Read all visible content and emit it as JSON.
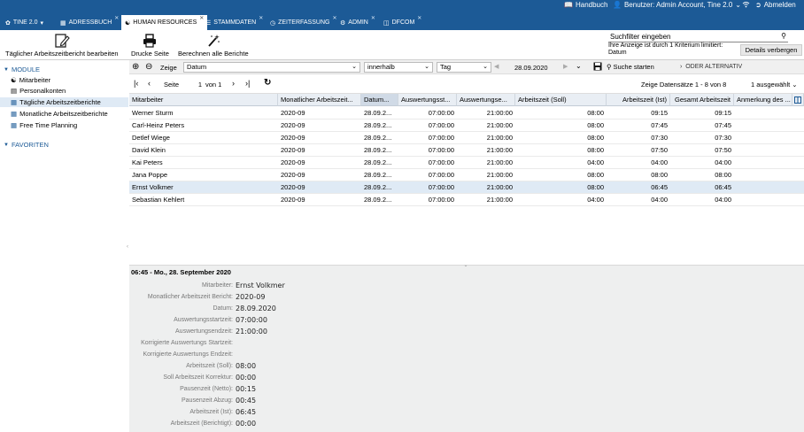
{
  "topbar": {
    "handbuch": "Handbuch",
    "benutzer": "Benutzer: Admin Account, Tine 2.0",
    "abmelden": "Abmelden"
  },
  "tabs": [
    {
      "label": "TINE 2.0"
    },
    {
      "label": "ADRESSBUCH"
    },
    {
      "label": "HUMAN RESOURCES"
    },
    {
      "label": "STAMMDATEN"
    },
    {
      "label": "ZEITERFASSUNG"
    },
    {
      "label": "ADMIN"
    },
    {
      "label": "DFCOM"
    }
  ],
  "toolbar": {
    "edit_label": "Täglicher Arbeitszeitbericht bearbeiten",
    "print_label": "Drucke Seite",
    "compute_label": "Berechnen alle Berichte",
    "search_placeholder": "Suchfilter eingeben",
    "filter_info_1": "Ihre Anzeige ist durch 1 Kriterium limitiert:",
    "filter_info_2": "Datum",
    "details_hide": "Details verbergen"
  },
  "sidebar": {
    "module": "MODULE",
    "items": [
      {
        "label": "Mitarbeiter"
      },
      {
        "label": "Personalkonten"
      },
      {
        "label": "Tägliche Arbeitszeitberichte"
      },
      {
        "label": "Monatliche Arbeitszeitberichte"
      },
      {
        "label": "Free Time Planning"
      }
    ],
    "favoriten": "FAVORITEN"
  },
  "filter": {
    "zeige": "Zeige",
    "field": "Datum",
    "operator": "innerhalb",
    "period": "Tag",
    "date": "28.09.2020",
    "start_search": "Suche starten",
    "or_alternative": "ODER ALTERNATIV"
  },
  "pager": {
    "seite": "Seite",
    "page": "1",
    "von": "von 1",
    "records": "Zeige Datensätze 1 - 8 von 8",
    "selected": "1 ausgewählt"
  },
  "grid": {
    "columns": [
      "Mitarbeiter",
      "Monatlicher Arbeitszeit...",
      "Datum...",
      "Auswertungsst...",
      "Auswertungse...",
      "Arbeitszeit (Soll)",
      "Arbeitszeit (Ist)",
      "Gesamt Arbeitszeit",
      "Anmerkung des ..."
    ],
    "rows": [
      [
        "Werner Sturm",
        "2020-09",
        "28.09.2...",
        "07:00:00",
        "21:00:00",
        "08:00",
        "09:15",
        "09:15",
        ""
      ],
      [
        "Carl-Heinz Peters",
        "2020-09",
        "28.09.2...",
        "07:00:00",
        "21:00:00",
        "08:00",
        "07:45",
        "07:45",
        ""
      ],
      [
        "Detlef Wiege",
        "2020-09",
        "28.09.2...",
        "07:00:00",
        "21:00:00",
        "08:00",
        "07:30",
        "07:30",
        ""
      ],
      [
        "David Klein",
        "2020-09",
        "28.09.2...",
        "07:00:00",
        "21:00:00",
        "08:00",
        "07:50",
        "07:50",
        ""
      ],
      [
        "Kai Peters",
        "2020-09",
        "28.09.2...",
        "07:00:00",
        "21:00:00",
        "04:00",
        "04:00",
        "04:00",
        ""
      ],
      [
        "Jana Poppe",
        "2020-09",
        "28.09.2...",
        "07:00:00",
        "21:00:00",
        "08:00",
        "08:00",
        "08:00",
        ""
      ],
      [
        "Ernst Volkmer",
        "2020-09",
        "28.09.2...",
        "07:00:00",
        "21:00:00",
        "08:00",
        "06:45",
        "06:45",
        ""
      ],
      [
        "Sebastian Kehlert",
        "2020-09",
        "28.09.2...",
        "07:00:00",
        "21:00:00",
        "04:00",
        "04:00",
        "04:00",
        ""
      ]
    ]
  },
  "detail": {
    "title": "06:45 - Mo., 28. September 2020",
    "fields": [
      {
        "label": "Mitarbeiter:",
        "value": "Ernst Volkmer"
      },
      {
        "label": "Monatlicher Arbeitszeit Bericht:",
        "value": "2020-09"
      },
      {
        "label": "Datum:",
        "value": "28.09.2020"
      },
      {
        "label": "Auswertungsstartzeit:",
        "value": "07:00:00"
      },
      {
        "label": "Auswertungsendzeit:",
        "value": "21:00:00"
      },
      {
        "label": "Korrigierte Auswertungs Startzeit:",
        "value": ""
      },
      {
        "label": "Korrigierte Auswertungs Endzeit:",
        "value": ""
      },
      {
        "label": "Arbeitszeit (Soll):",
        "value": "08:00"
      },
      {
        "label": "Soll Arbeitszeit Korrektur:",
        "value": "00:00"
      },
      {
        "label": "Pausenzeit (Netto):",
        "value": "00:15"
      },
      {
        "label": "Pausenzeit Abzug:",
        "value": "00:45"
      },
      {
        "label": "Arbeitszeit (Ist):",
        "value": "06:45"
      },
      {
        "label": "Arbeitszeit (Berichtigt):",
        "value": "00:00"
      }
    ]
  }
}
